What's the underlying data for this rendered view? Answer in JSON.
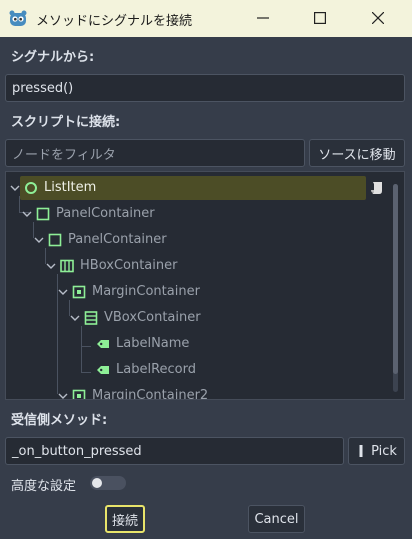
{
  "window": {
    "title": "メソッドにシグナルを接続"
  },
  "signal_section": {
    "label": "シグナルから:",
    "value": "pressed()"
  },
  "script_section": {
    "label": "スクリプトに接続:",
    "filter_placeholder": "ノードをフィルタ",
    "goto_source_label": "ソースに移動"
  },
  "tree": {
    "nodes": [
      {
        "label": "ListItem",
        "icon": "circle-node-icon",
        "selected": true
      },
      {
        "label": "PanelContainer",
        "icon": "panel-container-icon"
      },
      {
        "label": "PanelContainer",
        "icon": "panel-container-icon"
      },
      {
        "label": "HBoxContainer",
        "icon": "hbox-container-icon"
      },
      {
        "label": "MarginContainer",
        "icon": "margin-container-icon"
      },
      {
        "label": "VBoxContainer",
        "icon": "vbox-container-icon"
      },
      {
        "label": "LabelName",
        "icon": "label-icon"
      },
      {
        "label": "LabelRecord",
        "icon": "label-icon"
      },
      {
        "label": "MarginContainer2",
        "icon": "margin-container-icon"
      }
    ]
  },
  "method_section": {
    "label": "受信側メソッド:",
    "value": "_on_button_pressed",
    "pick_label": "Pick"
  },
  "advanced": {
    "label": "高度な設定",
    "enabled": false
  },
  "actions": {
    "connect_label": "接続",
    "cancel_label": "Cancel"
  },
  "colors": {
    "accent_green": "#8eef97",
    "selected_row": "#4c4d26",
    "connect_border": "#e8e46a",
    "panel_bg": "#363d4a"
  }
}
